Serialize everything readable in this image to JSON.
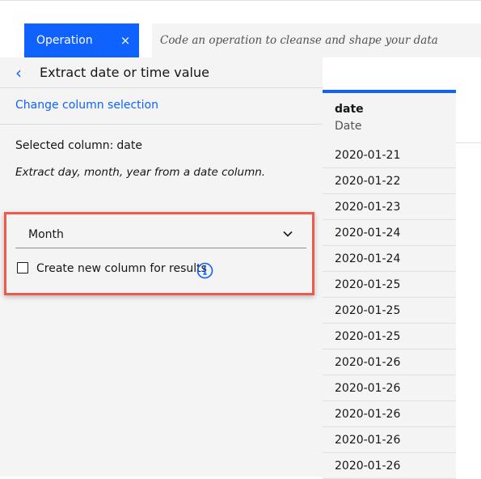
{
  "operation_tag": {
    "label": "Operation",
    "close": "×"
  },
  "code_input": {
    "placeholder": "Code an operation to cleanse and shape your data"
  },
  "panel": {
    "back_icon": "‹",
    "title": "Extract date or time value",
    "change_link": "Change column selection",
    "selected_label": "Selected column:",
    "selected_value": "date",
    "description": "Extract day, month, year from a date column."
  },
  "form": {
    "select_value": "Month",
    "checkbox_label": "Create new column for results"
  },
  "table": {
    "column_name": "date",
    "column_type": "Date",
    "rows": [
      "2020-01-21",
      "2020-01-22",
      "2020-01-23",
      "2020-01-24",
      "2020-01-24",
      "2020-01-25",
      "2020-01-25",
      "2020-01-25",
      "2020-01-26",
      "2020-01-26",
      "2020-01-26",
      "2020-01-26",
      "2020-01-26"
    ]
  },
  "colors": {
    "accent": "#0f62fe",
    "highlight": "#ee5b4d",
    "panel_bg": "#f4f4f4"
  },
  "icons": {
    "back": "chevron-left-icon",
    "close": "close-icon",
    "dropdown": "chevron-down-icon",
    "info": "info-icon"
  }
}
